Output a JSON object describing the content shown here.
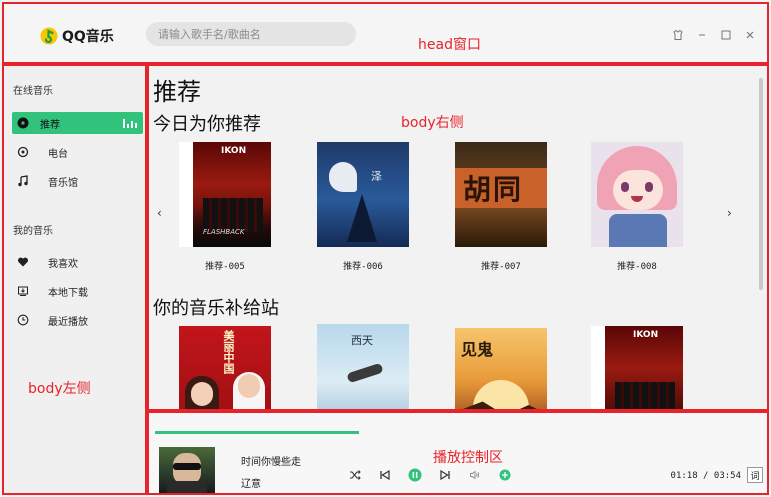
{
  "head": {
    "logo_text": "QQ音乐",
    "search_placeholder": "请输入歌手名/歌曲名",
    "region_label": "head窗口"
  },
  "sidebar": {
    "region_label": "body左侧",
    "section_online": "在线音乐",
    "section_mine": "我的音乐",
    "items": [
      {
        "label": "推荐",
        "icon": "record-icon"
      },
      {
        "label": "电台",
        "icon": "radio-icon"
      },
      {
        "label": "音乐馆",
        "icon": "music-note-icon"
      },
      {
        "label": "我喜欢",
        "icon": "heart-icon"
      },
      {
        "label": "本地下载",
        "icon": "download-icon"
      },
      {
        "label": "最近播放",
        "icon": "clock-icon"
      }
    ]
  },
  "main": {
    "region_label": "body右侧",
    "page_title": "推荐",
    "section_today": "今日为你推荐",
    "section_supply": "你的音乐补给站",
    "today_cards": [
      {
        "label": "推荐-005",
        "cover_text": "IKON"
      },
      {
        "label": "推荐-006",
        "cover_text": "泽"
      },
      {
        "label": "推荐-007",
        "cover_text": "胡同"
      },
      {
        "label": "推荐-008",
        "cover_text": ""
      }
    ],
    "supply_cards": [
      {
        "cover_text": "美丽中国"
      },
      {
        "cover_text": "西天"
      },
      {
        "cover_text": "见鬼"
      },
      {
        "cover_text": "IKON"
      }
    ]
  },
  "player": {
    "region_label": "播放控制区",
    "song_title": "时间你慢些走",
    "artist": "辽意",
    "time": "01:18 / 03:54",
    "lyric_label": "词",
    "progress": 0.33
  },
  "colors": {
    "accent": "#31c27c",
    "annotation": "#e8232b"
  }
}
